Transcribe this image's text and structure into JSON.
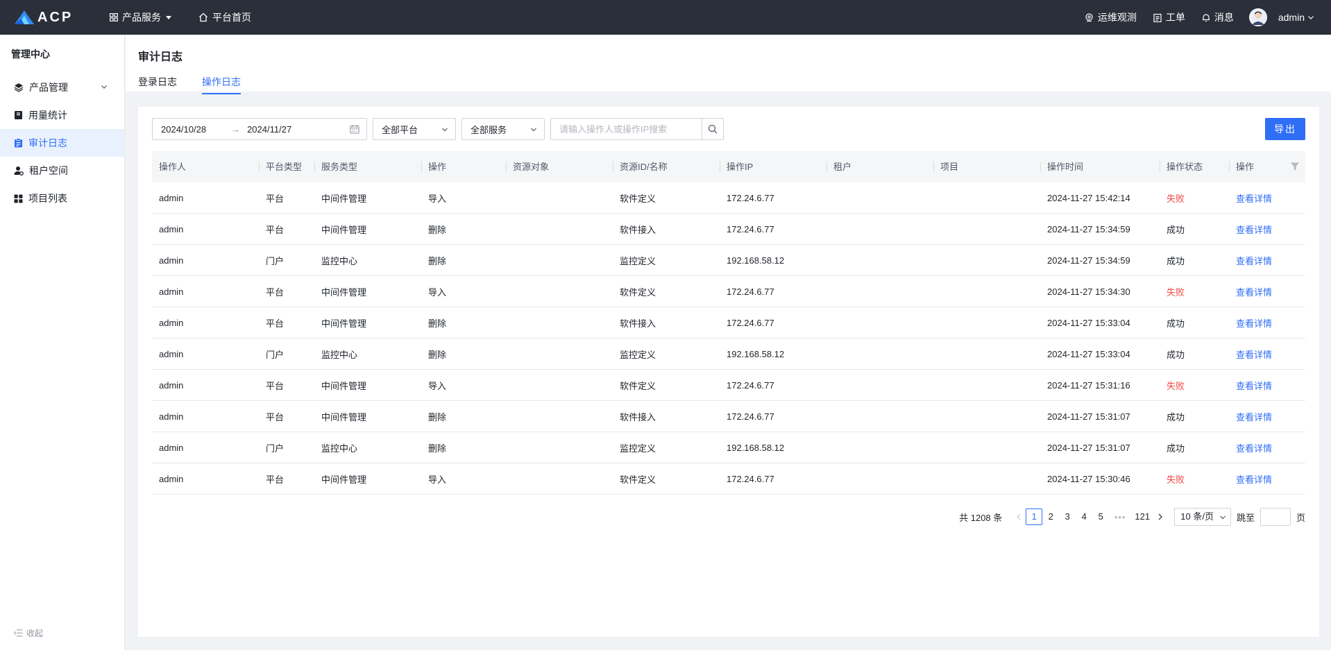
{
  "topbar": {
    "logo_text": "ACP",
    "nav": [
      {
        "label": "产品服务",
        "icon": "grid-icon"
      },
      {
        "label": "平台首页",
        "icon": "home-icon"
      }
    ],
    "right": [
      {
        "label": "运维观测",
        "icon": "location-icon"
      },
      {
        "label": "工单",
        "icon": "clipboard-icon"
      },
      {
        "label": "消息",
        "icon": "bell-icon"
      }
    ],
    "username": "admin"
  },
  "sidebar": {
    "title": "管理中心",
    "items": [
      {
        "label": "产品管理",
        "icon": "layers-icon"
      },
      {
        "label": "用量统计",
        "icon": "book-icon"
      },
      {
        "label": "审计日志",
        "icon": "clipboard-list-icon"
      },
      {
        "label": "租户空间",
        "icon": "user-gear-icon"
      },
      {
        "label": "项目列表",
        "icon": "apps-icon"
      }
    ],
    "collapse_label": "收起"
  },
  "header": {
    "title": "审计日志",
    "tabs": [
      {
        "label": "登录日志"
      },
      {
        "label": "操作日志"
      }
    ]
  },
  "filters": {
    "date_start": "2024/10/28",
    "date_end": "2024/11/27",
    "platform_select": "全部平台",
    "service_select": "全部服务",
    "search_placeholder": "请输入操作人或操作IP搜索",
    "export_label": "导出"
  },
  "table": {
    "columns": [
      "操作人",
      "平台类型",
      "服务类型",
      "操作",
      "资源对象",
      "资源ID/名称",
      "操作IP",
      "租户",
      "项目",
      "操作时间",
      "操作状态",
      "操作"
    ],
    "rows": [
      {
        "user": "admin",
        "platform": "平台",
        "service": "中间件管理",
        "op": "导入",
        "resource": "",
        "resource_id": "软件定义",
        "ip": "172.24.6.77",
        "tenant": "",
        "project": "",
        "time": "2024-11-27 15:42:14",
        "status": "失败",
        "action": "查看详情"
      },
      {
        "user": "admin",
        "platform": "平台",
        "service": "中间件管理",
        "op": "删除",
        "resource": "",
        "resource_id": "软件接入",
        "ip": "172.24.6.77",
        "tenant": "",
        "project": "",
        "time": "2024-11-27 15:34:59",
        "status": "成功",
        "action": "查看详情"
      },
      {
        "user": "admin",
        "platform": "门户",
        "service": "监控中心",
        "op": "删除",
        "resource": "",
        "resource_id": "监控定义",
        "ip": "192.168.58.12",
        "tenant": "",
        "project": "",
        "time": "2024-11-27 15:34:59",
        "status": "成功",
        "action": "查看详情"
      },
      {
        "user": "admin",
        "platform": "平台",
        "service": "中间件管理",
        "op": "导入",
        "resource": "",
        "resource_id": "软件定义",
        "ip": "172.24.6.77",
        "tenant": "",
        "project": "",
        "time": "2024-11-27 15:34:30",
        "status": "失败",
        "action": "查看详情"
      },
      {
        "user": "admin",
        "platform": "平台",
        "service": "中间件管理",
        "op": "删除",
        "resource": "",
        "resource_id": "软件接入",
        "ip": "172.24.6.77",
        "tenant": "",
        "project": "",
        "time": "2024-11-27 15:33:04",
        "status": "成功",
        "action": "查看详情"
      },
      {
        "user": "admin",
        "platform": "门户",
        "service": "监控中心",
        "op": "删除",
        "resource": "",
        "resource_id": "监控定义",
        "ip": "192.168.58.12",
        "tenant": "",
        "project": "",
        "time": "2024-11-27 15:33:04",
        "status": "成功",
        "action": "查看详情"
      },
      {
        "user": "admin",
        "platform": "平台",
        "service": "中间件管理",
        "op": "导入",
        "resource": "",
        "resource_id": "软件定义",
        "ip": "172.24.6.77",
        "tenant": "",
        "project": "",
        "time": "2024-11-27 15:31:16",
        "status": "失败",
        "action": "查看详情"
      },
      {
        "user": "admin",
        "platform": "平台",
        "service": "中间件管理",
        "op": "删除",
        "resource": "",
        "resource_id": "软件接入",
        "ip": "172.24.6.77",
        "tenant": "",
        "project": "",
        "time": "2024-11-27 15:31:07",
        "status": "成功",
        "action": "查看详情"
      },
      {
        "user": "admin",
        "platform": "门户",
        "service": "监控中心",
        "op": "删除",
        "resource": "",
        "resource_id": "监控定义",
        "ip": "192.168.58.12",
        "tenant": "",
        "project": "",
        "time": "2024-11-27 15:31:07",
        "status": "成功",
        "action": "查看详情"
      },
      {
        "user": "admin",
        "platform": "平台",
        "service": "中间件管理",
        "op": "导入",
        "resource": "",
        "resource_id": "软件定义",
        "ip": "172.24.6.77",
        "tenant": "",
        "project": "",
        "time": "2024-11-27 15:30:46",
        "status": "失败",
        "action": "查看详情"
      }
    ]
  },
  "pagination": {
    "total": "共 1208 条",
    "pages": [
      "1",
      "2",
      "3",
      "4",
      "5"
    ],
    "ellipsis": "•••",
    "last_page": "121",
    "page_size": "10 条/页",
    "jump_label": "跳至",
    "page_unit": "页"
  },
  "colors": {
    "accent": "#2f6ef6",
    "topbar": "#2b2f3a",
    "fail": "#f54a45"
  }
}
